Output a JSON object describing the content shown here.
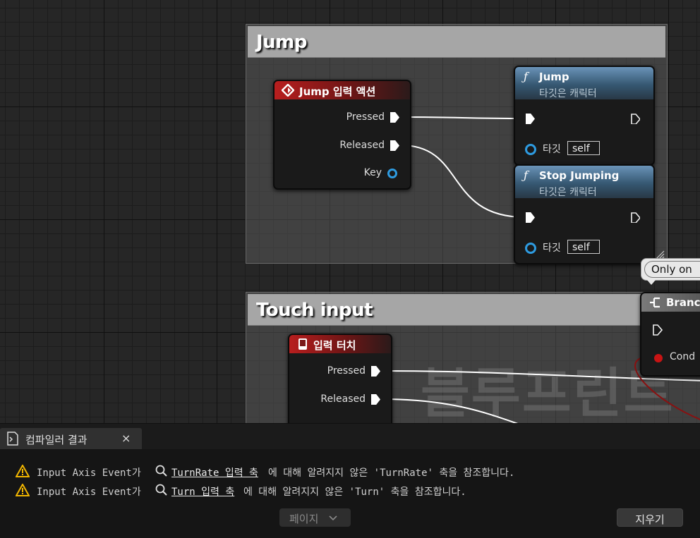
{
  "graph": {
    "comments": [
      {
        "id": "jump",
        "title": "Jump"
      },
      {
        "id": "touch",
        "title": "Touch input"
      }
    ],
    "nodes": {
      "jump_input": {
        "title": "Jump 입력 액션",
        "pins": [
          "Pressed",
          "Released",
          "Key"
        ]
      },
      "jump_func": {
        "title": "Jump",
        "subtitle": "타깃은 캐릭터",
        "target_label": "타깃",
        "target_value": "self"
      },
      "stop_jumping": {
        "title": "Stop Jumping",
        "subtitle": "타깃은 캐릭터",
        "target_label": "타깃",
        "target_value": "self"
      },
      "touch_input": {
        "title": "입력 터치",
        "pins": [
          "Pressed",
          "Released"
        ]
      },
      "branch": {
        "title": "Branc",
        "cond_label": "Cond"
      }
    },
    "bubble": "Only on",
    "watermark": "블루프린트"
  },
  "panel": {
    "tab_title": "컴파일러 결과",
    "close_glyph": "×",
    "messages": [
      {
        "prefix": "Input Axis Event가",
        "link": "TurnRate 입력 축",
        "suffix": "에 대해 알려지지 않은 'TurnRate' 축을 참조합니다."
      },
      {
        "prefix": "Input Axis Event가",
        "link": "Turn 입력 축",
        "suffix": "에 대해 알려지지 않은 'Turn' 축을 참조합니다."
      }
    ],
    "page_button": "페이지",
    "clear_button": "지우기"
  },
  "colors": {
    "warning": "#f2b600",
    "event_red": "#b81e1e",
    "function_blue": "#4b7a9e",
    "pin_blue": "#2e9be0",
    "bool_red": "#c81414"
  },
  "icons": [
    "event-diamond-icon",
    "function-icon",
    "exec-pin-icon",
    "touch-phone-icon",
    "branch-icon",
    "warning-icon",
    "search-icon",
    "chevron-down-icon",
    "document-log-icon",
    "close-icon"
  ]
}
